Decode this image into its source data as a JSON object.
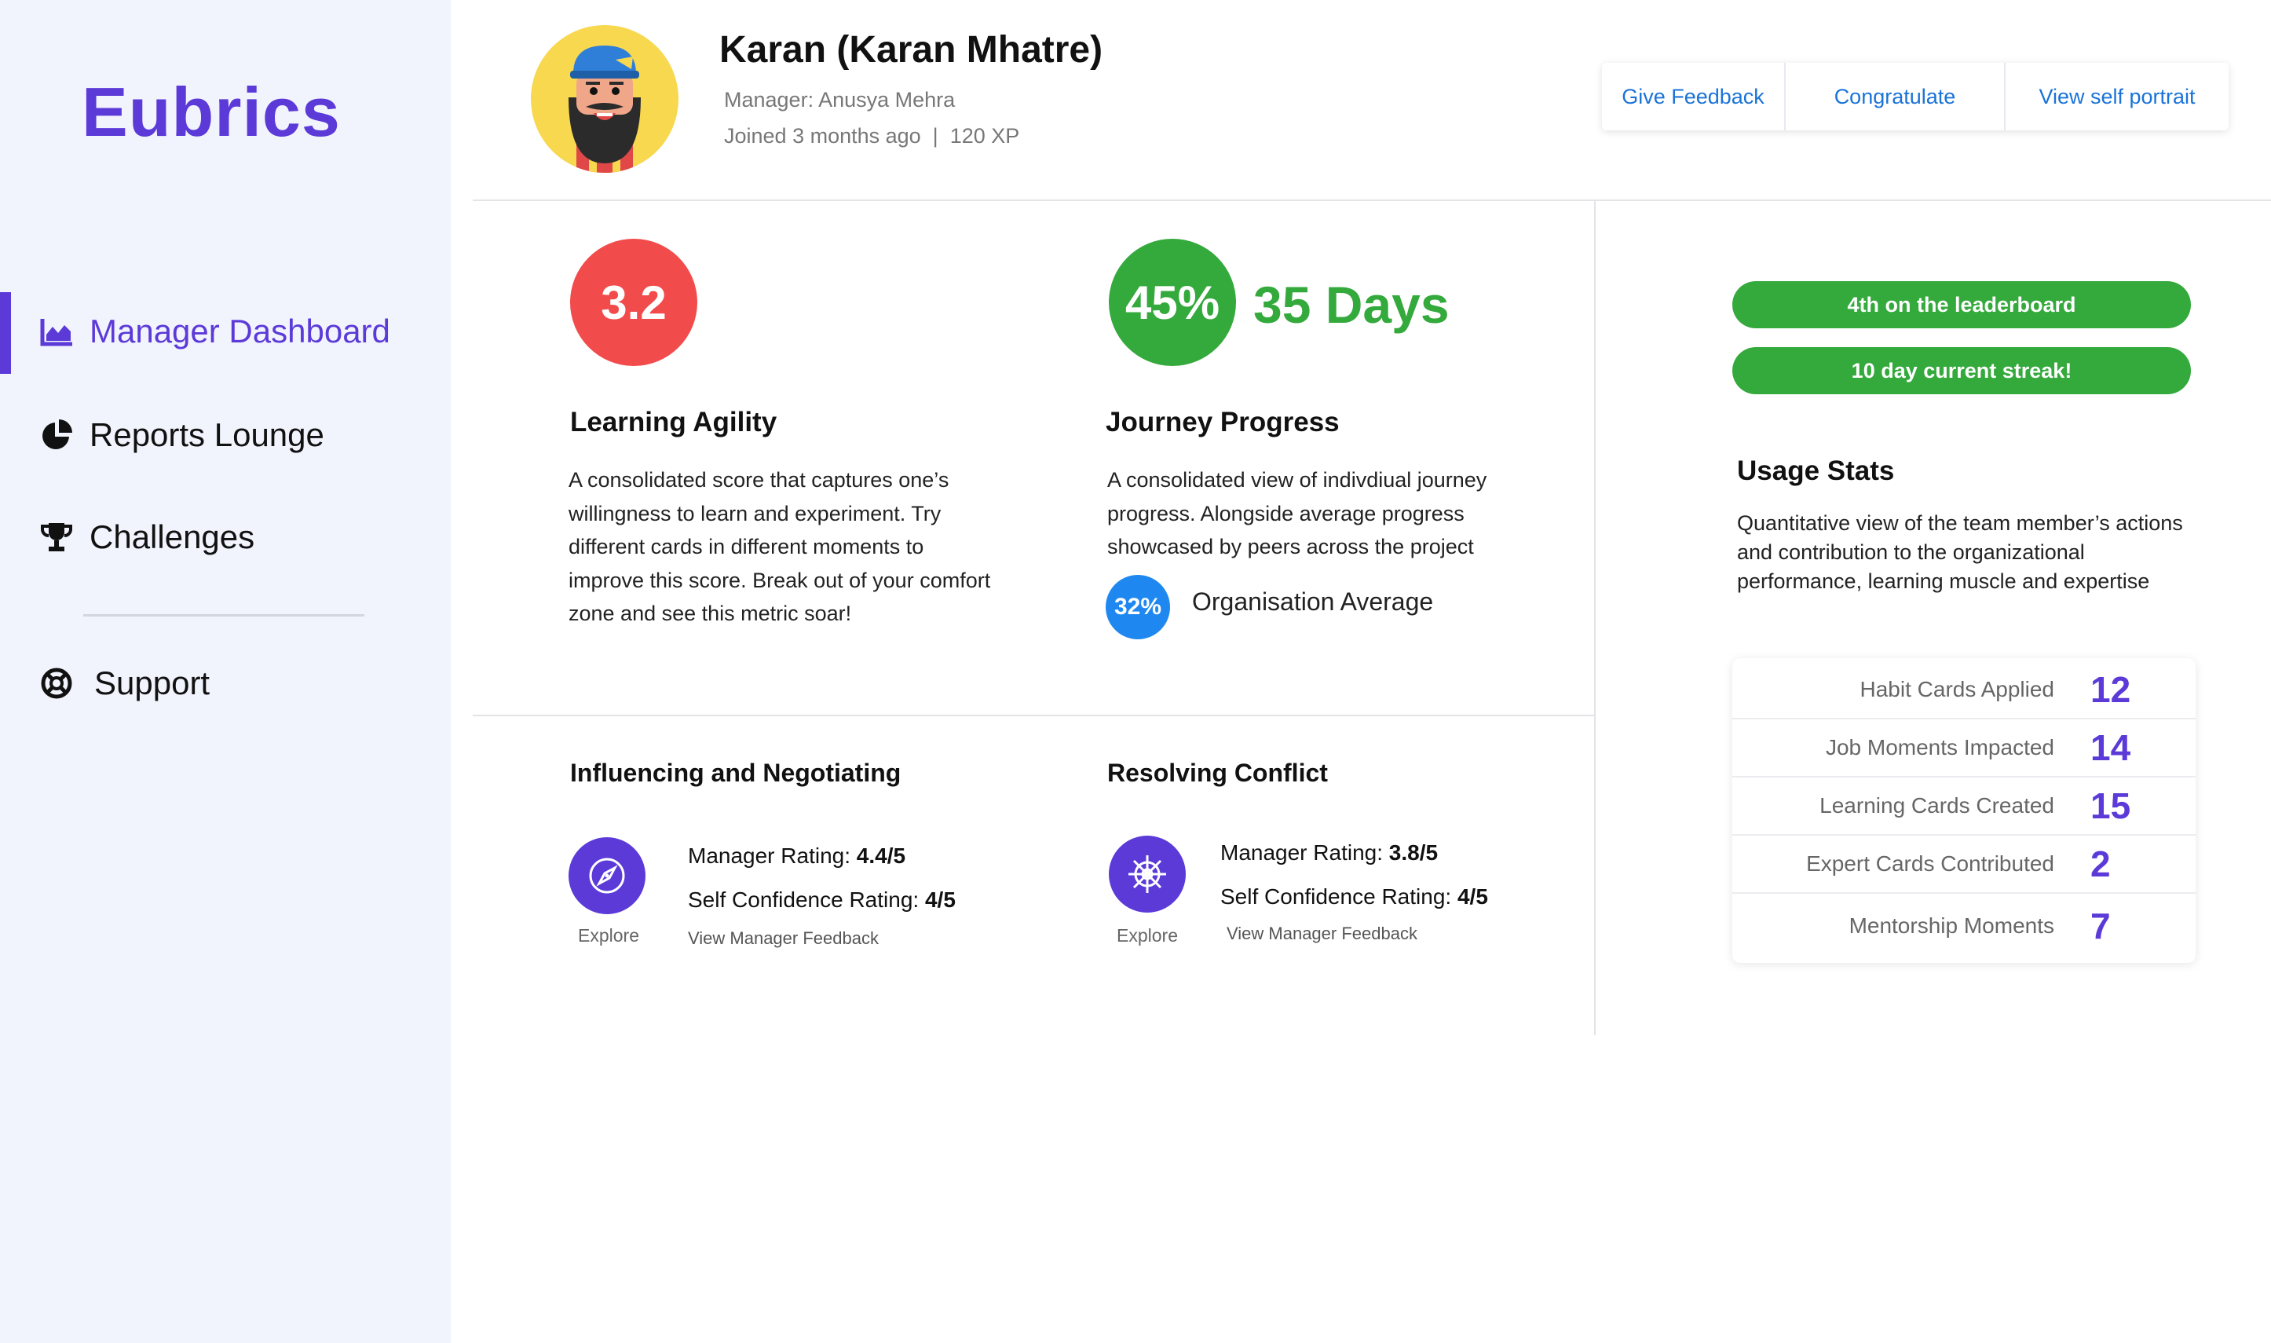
{
  "app": {
    "logo": "Eubrics"
  },
  "sidebar": {
    "items": [
      {
        "label": "Manager Dashboard",
        "icon": "area-chart-icon",
        "active": true
      },
      {
        "label": "Reports Lounge",
        "icon": "pie-chart-icon",
        "active": false
      },
      {
        "label": "Challenges",
        "icon": "trophy-icon",
        "active": false
      },
      {
        "label": "Support",
        "icon": "lifebuoy-icon",
        "active": false
      }
    ]
  },
  "profile": {
    "name": "Karan (Karan Mhatre)",
    "manager": "Manager: Anusya Mehra",
    "joined": "Joined 3 months ago  |  120 XP"
  },
  "actions": {
    "give_feedback": "Give Feedback",
    "congratulate": "Congratulate",
    "view_portrait": "View self portrait"
  },
  "learning_agility": {
    "score": "3.2",
    "title": "Learning Agility",
    "lines": [
      "A consolidated score that captures one’s",
      "willingness to learn and experiment. Try",
      "different cards in different moments to",
      "improve this score. Break out of your comfort",
      "zone and see this metric soar!"
    ]
  },
  "journey": {
    "percent": "45%",
    "days": "35 Days",
    "title": "Journey Progress",
    "lines": [
      "A consolidated view of indivdiual journey",
      "progress. Alongside average progress",
      "showcased by peers across the project"
    ],
    "org_percent": "32%",
    "org_label": "Organisation Average"
  },
  "badges": {
    "leaderboard": "4th on the leaderboard",
    "streak": "10 day current streak!"
  },
  "usage": {
    "title": "Usage Stats",
    "desc": "Quantitative view of the team member’s actions and contribution to the organizational performance, learning muscle and expertise",
    "stats": [
      {
        "label": "Habit Cards Applied",
        "value": "12"
      },
      {
        "label": "Job Moments Impacted",
        "value": "14"
      },
      {
        "label": "Learning Cards Created",
        "value": "15"
      },
      {
        "label": "Expert Cards Contributed",
        "value": "2"
      },
      {
        "label": "Mentorship Moments",
        "value": "7"
      }
    ]
  },
  "skills": [
    {
      "title": "Influencing and Negotiating",
      "icon": "compass-icon",
      "explore": "Explore",
      "manager_label": "Manager Rating: ",
      "manager_value": "4.4/5",
      "self_label": "Self Confidence Rating: ",
      "self_value": "4/5",
      "feedback": "View Manager Feedback"
    },
    {
      "title": "Resolving Conflict",
      "icon": "ship-wheel-icon",
      "explore": "Explore",
      "manager_label": "Manager Rating: ",
      "manager_value": "3.8/5",
      "self_label": "Self Confidence Rating: ",
      "self_value": "4/5",
      "feedback": "View Manager Feedback"
    }
  ],
  "colors": {
    "brand": "#5b3ad8",
    "score_red": "#f24b4b",
    "progress_green": "#34a93c",
    "org_blue": "#1e88f0",
    "link_blue": "#1a73d8",
    "sidebar_bg": "#f2f4fd"
  }
}
